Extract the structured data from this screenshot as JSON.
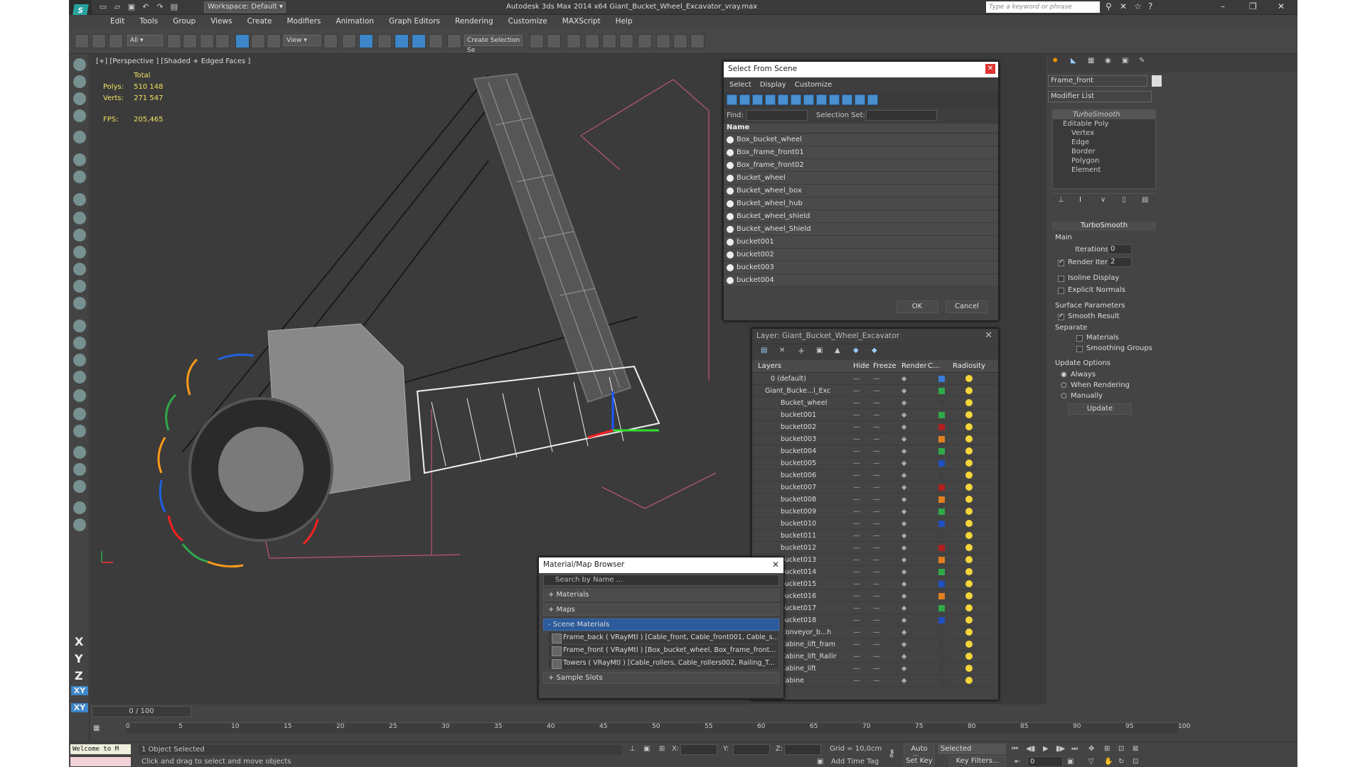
{
  "titlebar": {
    "title": "Autodesk 3ds Max  2014 x64     Giant_Bucket_Wheel_Excavator_vray.max",
    "workspace": "Workspace: Default",
    "search_placeholder": "Type a keyword or phrase"
  },
  "menu": [
    "Edit",
    "Tools",
    "Group",
    "Views",
    "Create",
    "Modifiers",
    "Animation",
    "Graph Editors",
    "Rendering",
    "Customize",
    "MAXScript",
    "Help"
  ],
  "toolbar": {
    "filter": "All",
    "refcoord": "View",
    "selset": "Create Selection Se"
  },
  "viewport": {
    "label": "[+] [Perspective ] [Shaded + Edged Faces ]",
    "stats": {
      "total": "Total",
      "polys_label": "Polys:",
      "polys": "510 148",
      "verts_label": "Verts:",
      "verts": "271 547",
      "fps_label": "FPS:",
      "fps": "205,465"
    }
  },
  "select_from_scene": {
    "title": "Select From Scene",
    "menu": [
      "Select",
      "Display",
      "Customize"
    ],
    "find_label": "Find:",
    "selset_label": "Selection Set:",
    "col_name": "Name",
    "items": [
      "Box_bucket_wheel",
      "Box_frame_front01",
      "Box_frame_front02",
      "Bucket_wheel",
      "Bucket_wheel_box",
      "Bucket_wheel_hub",
      "Bucket_wheel_shield",
      "Bucket_wheel_Shield",
      "bucket001",
      "bucket002",
      "bucket003",
      "bucket004"
    ],
    "ok": "OK",
    "cancel": "Cancel"
  },
  "layer": {
    "title": "Layer: Giant_Bucket_Wheel_Excavator",
    "cols": [
      "Layers",
      "Hide",
      "Freeze",
      "Render",
      "C...",
      "Radiosity"
    ],
    "rows": [
      {
        "name": "0 (default)",
        "color": "#3a7ad8"
      },
      {
        "name": "Giant_Bucke...l_Exc",
        "color": "#2fa84a"
      },
      {
        "name": "Bucket_wheel",
        "color": "#404040"
      },
      {
        "name": "bucket001",
        "color": "#2fa84a"
      },
      {
        "name": "bucket002",
        "color": "#b02020"
      },
      {
        "name": "bucket003",
        "color": "#e08020"
      },
      {
        "name": "bucket004",
        "color": "#2fa84a"
      },
      {
        "name": "bucket005",
        "color": "#2050c0"
      },
      {
        "name": "bucket006",
        "color": "#404040"
      },
      {
        "name": "bucket007",
        "color": "#b02020"
      },
      {
        "name": "bucket008",
        "color": "#e08020"
      },
      {
        "name": "bucket009",
        "color": "#2fa84a"
      },
      {
        "name": "bucket010",
        "color": "#2050c0"
      },
      {
        "name": "bucket011",
        "color": "#404040"
      },
      {
        "name": "bucket012",
        "color": "#b02020"
      },
      {
        "name": "bucket013",
        "color": "#e08020"
      },
      {
        "name": "bucket014",
        "color": "#2fa84a"
      },
      {
        "name": "bucket015",
        "color": "#2050c0"
      },
      {
        "name": "bucket016",
        "color": "#e08020"
      },
      {
        "name": "bucket017",
        "color": "#2fa84a"
      },
      {
        "name": "bucket018",
        "color": "#2050c0"
      },
      {
        "name": "Conveyor_b...h",
        "color": "#404040"
      },
      {
        "name": "Cabine_lift_fram",
        "color": "#404040"
      },
      {
        "name": "Cabine_lift_Railir",
        "color": "#404040"
      },
      {
        "name": "Cabine_lift",
        "color": "#404040"
      },
      {
        "name": "Cabine",
        "color": "#404040"
      }
    ]
  },
  "material_browser": {
    "title": "Material/Map Browser",
    "search": "Search by Name ...",
    "sections": [
      "+ Materials",
      "+ Maps",
      "- Scene Materials",
      "+ Sample Slots"
    ],
    "items": [
      "Frame_back  ( VRayMtl ) [Cable_front, Cable_front001, Cable_s...",
      "Frame_front  ( VRayMtl ) [Box_bucket_wheel, Box_frame_front...",
      "Towers  ( VRayMtl ) [Cable_rollers, Cable_rollers002, Railing_T..."
    ]
  },
  "command_panel": {
    "object_name": "Frame_front",
    "modifier_list": "Modifier List",
    "stack": [
      "TurboSmooth",
      "Editable Poly",
      "Vertex",
      "Edge",
      "Border",
      "Polygon",
      "Element"
    ],
    "turbosmooth": "TurboSmooth",
    "main": "Main",
    "iterations_label": "Iterations:",
    "iterations": "0",
    "render_iters_label": "Render Iters:",
    "render_iters": "2",
    "isoline": "Isoline Display",
    "explicit": "Explicit Normals",
    "surface": "Surface Parameters",
    "smooth_result": "Smooth Result",
    "separate": "Separate",
    "materials": "Materials",
    "smoothing_groups": "Smoothing Groups",
    "update_options": "Update Options",
    "always": "Always",
    "when_rendering": "When Rendering",
    "manually": "Manually",
    "update": "Update"
  },
  "timeline": {
    "frame": "0 / 100",
    "ticks": [
      "0",
      "5",
      "10",
      "15",
      "20",
      "25",
      "30",
      "35",
      "40",
      "45",
      "50",
      "55",
      "60",
      "65",
      "70",
      "75",
      "80",
      "85",
      "90",
      "95",
      "100"
    ]
  },
  "status": {
    "welcome": "Welcome to M",
    "selected": "1 Object Selected",
    "prompt": "Click and drag to select and move objects",
    "x": "X:",
    "y": "Y:",
    "z": "Z:",
    "grid": "Grid = 10,0cm",
    "add_time_tag": "Add Time Tag",
    "auto_key": "Auto Key",
    "set_key": "Set Key",
    "selected_dd": "Selected",
    "key_filters": "Key Filters...",
    "frame": "0"
  },
  "left_axes": [
    "X",
    "Y",
    "Z",
    "XY",
    "XY"
  ]
}
